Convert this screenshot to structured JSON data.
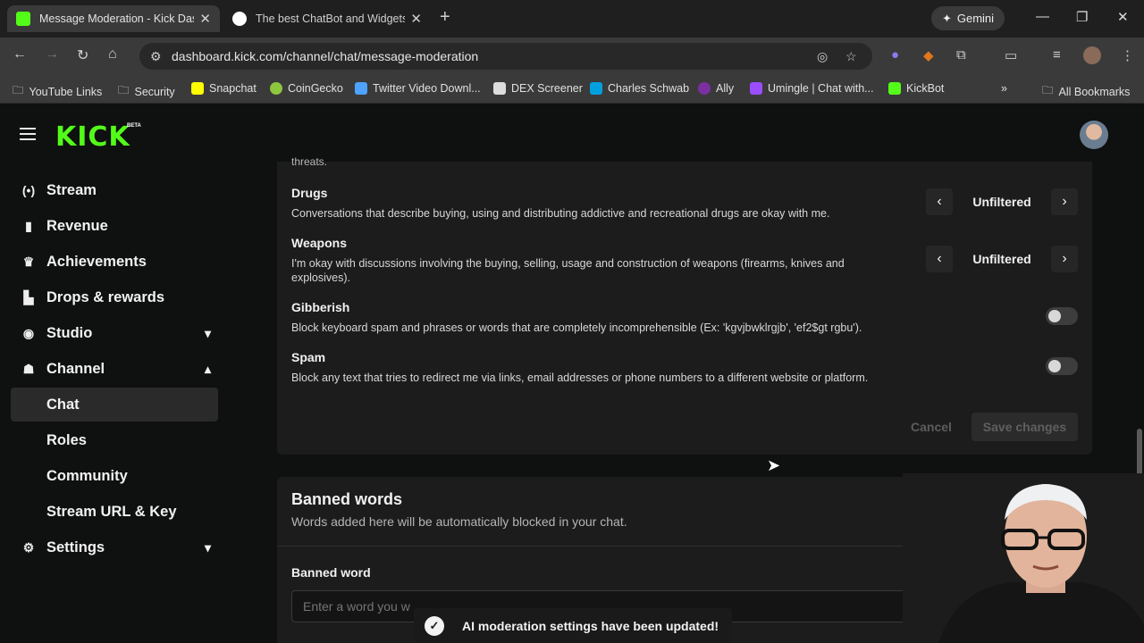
{
  "browser": {
    "tabs": [
      {
        "title": "Message Moderation - Kick Das",
        "active": true
      },
      {
        "title": "The best ChatBot and Widgets f",
        "active": false
      }
    ],
    "gemini_label": "Gemini",
    "url": "dashboard.kick.com/channel/chat/message-moderation",
    "bookmarks": [
      "YouTube Links",
      "Security",
      "Snapchat",
      "CoinGecko",
      "Twitter Video Downl...",
      "DEX Screener",
      "Charles Schwab",
      "Ally",
      "Umingle | Chat with...",
      "KickBot"
    ],
    "bookmarks_more": "»",
    "all_bookmarks": "All Bookmarks"
  },
  "app": {
    "logo": "KICK",
    "beta": "BETA"
  },
  "sidebar": {
    "items": [
      {
        "label": "Stream",
        "icon": "broadcast-icon"
      },
      {
        "label": "Revenue",
        "icon": "chart-icon"
      },
      {
        "label": "Achievements",
        "icon": "trophy-icon"
      },
      {
        "label": "Drops & rewards",
        "icon": "gift-icon"
      },
      {
        "label": "Studio",
        "icon": "studio-icon"
      },
      {
        "label": "Channel",
        "icon": "person-icon"
      },
      {
        "label": "Chat"
      },
      {
        "label": "Roles"
      },
      {
        "label": "Community"
      },
      {
        "label": "Stream URL & Key"
      },
      {
        "label": "Settings",
        "icon": "gear-icon"
      }
    ]
  },
  "moderation": {
    "cut_text": "threats.",
    "options": [
      {
        "title": "Drugs",
        "desc": "Conversations that describe buying, using and distributing addictive and recreational drugs are okay with me.",
        "value": "Unfiltered"
      },
      {
        "title": "Weapons",
        "desc": "I'm okay with discussions involving the buying, selling, usage and construction of weapons (firearms, knives and explosives).",
        "value": "Unfiltered"
      },
      {
        "title": "Gibberish",
        "desc": "Block keyboard spam and phrases or words that are completely incomprehensible (Ex: 'kgvjbwklrgjb', 'ef2$gt rgbu').",
        "enabled": false
      },
      {
        "title": "Spam",
        "desc": "Block any text that tries to redirect me via links, email addresses or phone numbers to a different website or platform.",
        "enabled": false
      }
    ],
    "cancel_label": "Cancel",
    "save_label": "Save changes"
  },
  "banned": {
    "title": "Banned words",
    "desc": "Words added here will be automatically blocked in your chat.",
    "field_label": "Banned word",
    "placeholder": "Enter a word you w"
  },
  "toast": {
    "message": "AI moderation settings have been updated!"
  },
  "colors": {
    "brand": "#53fc18",
    "bg": "#0f1010",
    "card": "#1c1c1c"
  }
}
